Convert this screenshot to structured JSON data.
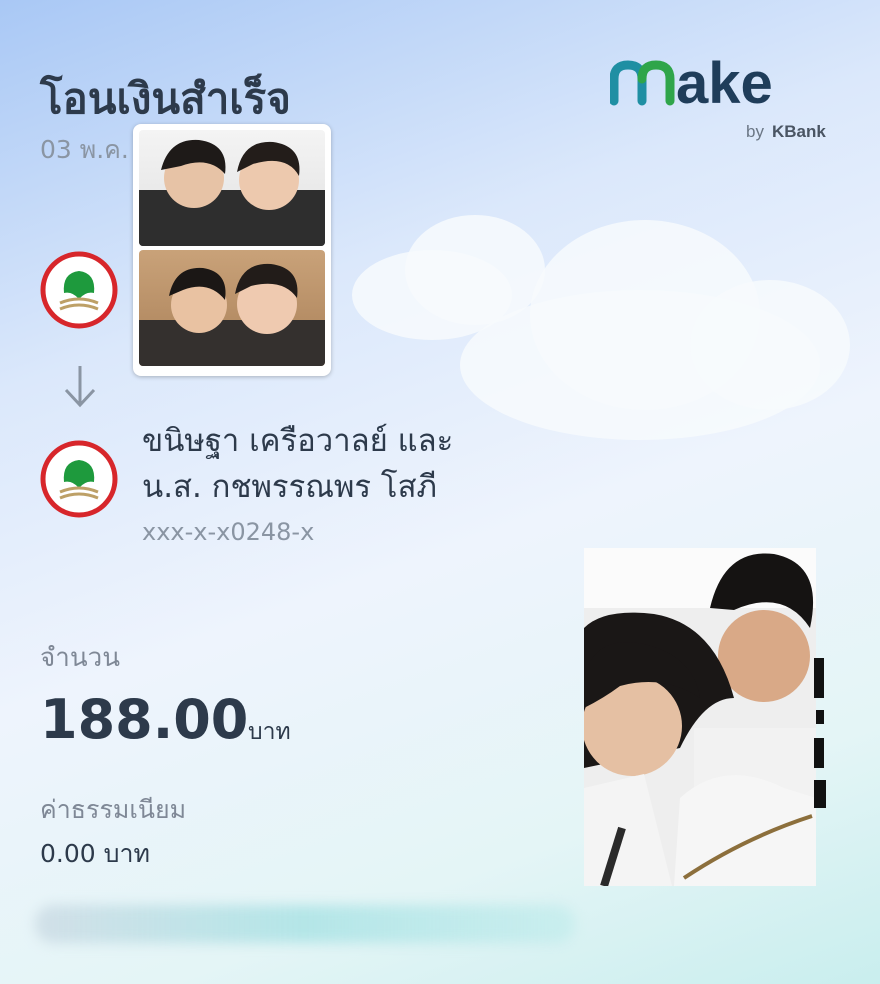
{
  "header": {
    "title": "โอนเงินสำเร็จ",
    "date": "03 พ.ค. 2"
  },
  "brand": {
    "logo_text": "make",
    "sub_text": "by KBank",
    "color_teal": "#1f8fa3",
    "color_green": "#2fa54a",
    "color_navy": "#1f3d5a"
  },
  "recipient": {
    "name_line1": "ขนิษฐา เครือวาลย์ และ",
    "name_line2": "น.ส. กชพรรณพร โสภี",
    "account": "xxx-x-x0248-x"
  },
  "amount": {
    "label": "จำนวน",
    "value": "188.00",
    "unit": "บาท"
  },
  "fee": {
    "label": "ค่าธรรมเนียม",
    "value": "0.00 บาท"
  },
  "icons": {
    "sender_bank": "kbank-logo-icon",
    "arrow": "arrow-down-icon",
    "recipient_bank": "kbank-logo-icon"
  }
}
